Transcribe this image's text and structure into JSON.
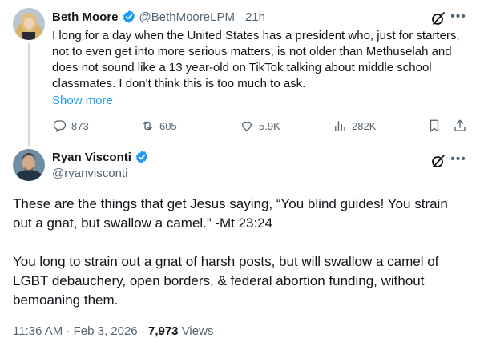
{
  "tweet1": {
    "name": "Beth Moore",
    "handle": "@BethMooreLPM",
    "separator": "·",
    "time": "21h",
    "text": "I long for a day when the United States has a president who, just for starters, not to even get into more serious matters, is not older than Methuselah and does not sound like a 13 year-old on TikTok talking about middle school classmates. I don't think this is too much to ask.",
    "show_more": "Show more",
    "replies": "873",
    "retweets": "605",
    "likes": "5.9K",
    "views": "282K"
  },
  "tweet2": {
    "name": "Ryan Visconti",
    "handle": "@ryanvisconti",
    "paragraph1": "These are the things that get Jesus saying, “You blind guides! You strain out a gnat, but swallow a camel.” -Mt 23:24",
    "paragraph2": "You long to strain out a gnat of harsh posts, but will swallow a camel of LGBT debauchery, open borders, & federal abortion funding, without bemoaning them.",
    "timestamp": "11:36 AM · Feb 3, 2026 · ",
    "views_count": "7,973",
    "views_label": " Views"
  },
  "colors": {
    "accent": "#1d9bf0",
    "secondary_text": "#536471",
    "primary_text": "#0f1419"
  }
}
